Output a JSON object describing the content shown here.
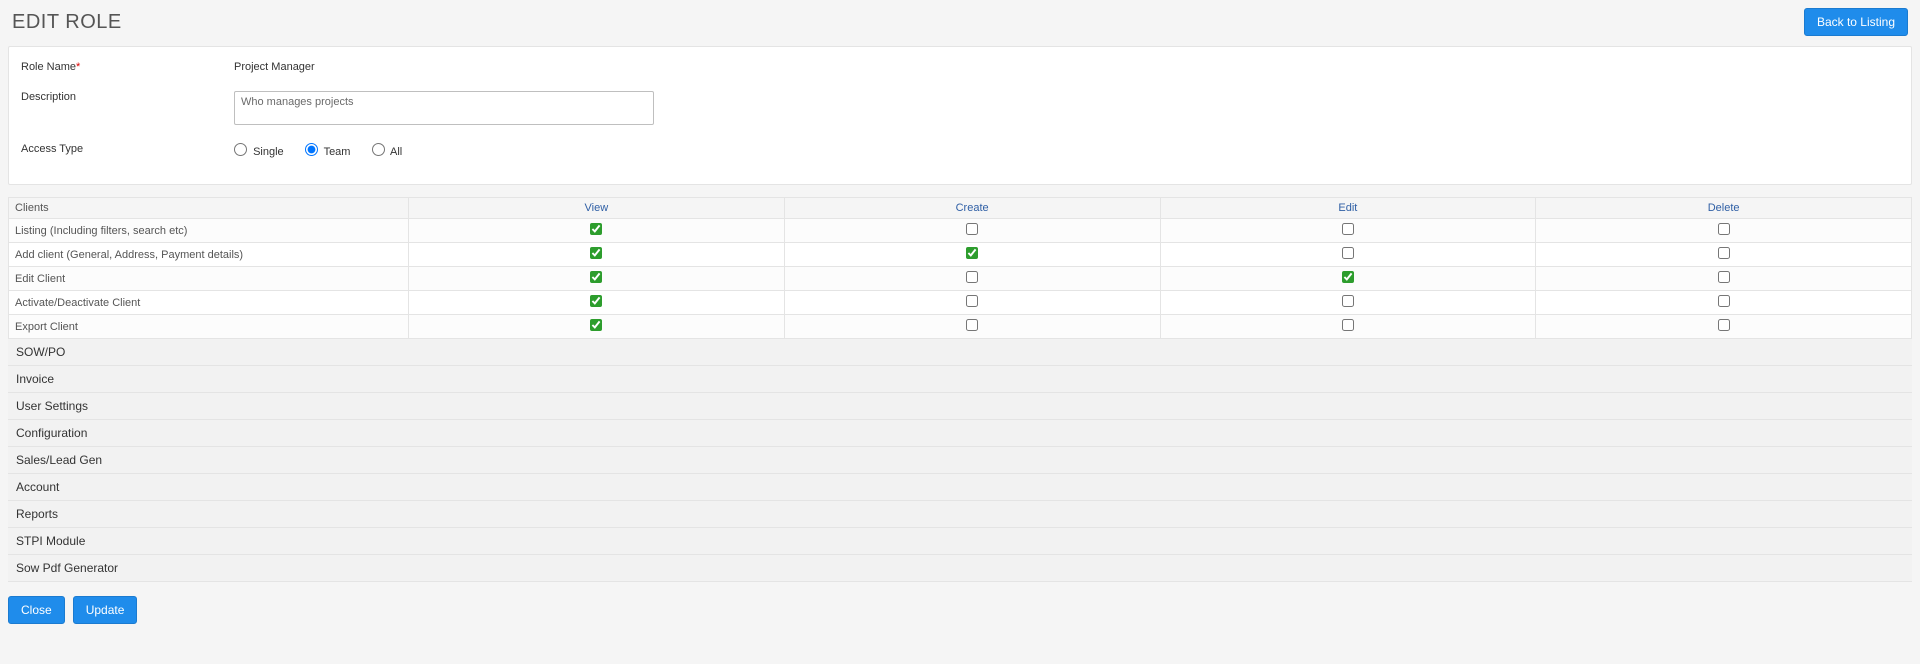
{
  "colors": {
    "primary": "#1f8ceb"
  },
  "header": {
    "title": "EDIT ROLE",
    "back_btn": "Back to Listing"
  },
  "form": {
    "role_name_label": "Role Name",
    "role_name_req": "*",
    "role_name_value": "Project Manager",
    "description_label": "Description",
    "description_value": "Who manages projects",
    "access_type_label": "Access Type",
    "access_options": {
      "single": "Single",
      "team": "Team",
      "all": "All"
    },
    "access_selected": "team"
  },
  "perm_columns": [
    "View",
    "Create",
    "Edit",
    "Delete"
  ],
  "sections": [
    {
      "name": "Clients",
      "expanded": true,
      "rows": [
        {
          "label": "Listing (Including filters, search etc)",
          "perms": [
            true,
            false,
            false,
            false
          ]
        },
        {
          "label": "Add client (General, Address, Payment details)",
          "perms": [
            true,
            true,
            false,
            false
          ]
        },
        {
          "label": "Edit Client",
          "perms": [
            true,
            false,
            true,
            false
          ]
        },
        {
          "label": "Activate/Deactivate Client",
          "perms": [
            true,
            false,
            false,
            false
          ]
        },
        {
          "label": "Export Client",
          "perms": [
            true,
            false,
            false,
            false
          ]
        }
      ]
    },
    {
      "name": "SOW/PO",
      "expanded": false
    },
    {
      "name": "Invoice",
      "expanded": false
    },
    {
      "name": "User Settings",
      "expanded": false
    },
    {
      "name": "Configuration",
      "expanded": false
    },
    {
      "name": "Sales/Lead Gen",
      "expanded": false
    },
    {
      "name": "Account",
      "expanded": false
    },
    {
      "name": "Reports",
      "expanded": false
    },
    {
      "name": "STPI Module",
      "expanded": false
    },
    {
      "name": "Sow Pdf Generator",
      "expanded": false
    }
  ],
  "footer": {
    "close": "Close",
    "update": "Update"
  }
}
